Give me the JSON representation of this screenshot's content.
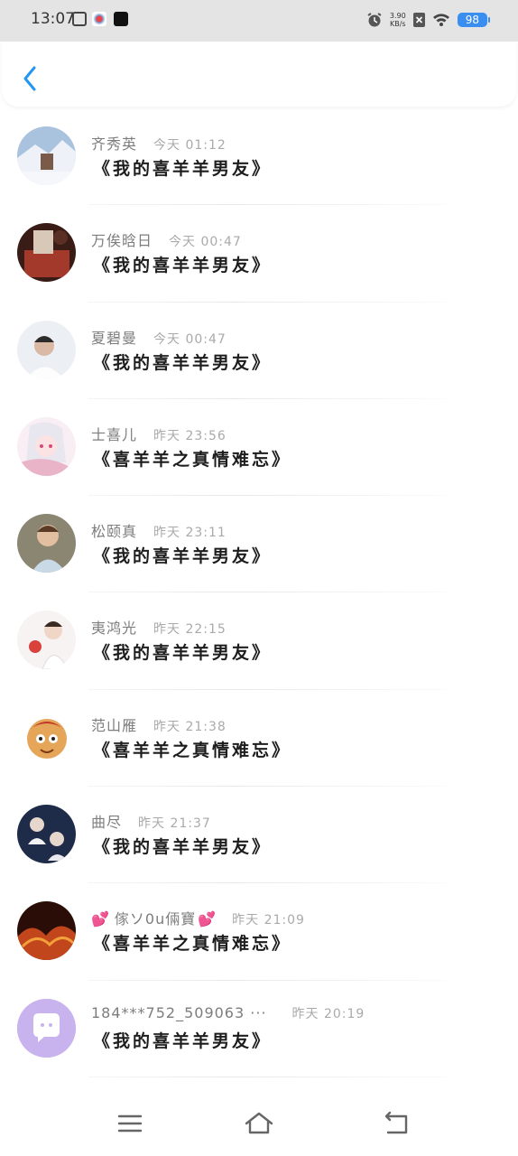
{
  "status_bar": {
    "time": "13:07",
    "net_speed_value": "3.90",
    "net_speed_unit": "KB/s",
    "battery": "98"
  },
  "comments": [
    {
      "user": "齐秀英",
      "time": "今天 01:12",
      "text": "《我的喜羊羊男友》"
    },
    {
      "user": "万俟晗日",
      "time": "今天 00:47",
      "text": "《我的喜羊羊男友》"
    },
    {
      "user": "夏碧曼",
      "time": "今天 00:47",
      "text": "《我的喜羊羊男友》"
    },
    {
      "user": "士喜儿",
      "time": "昨天 23:56",
      "text": "《喜羊羊之真情难忘》"
    },
    {
      "user": "松颐真",
      "time": "昨天 23:11",
      "text": "《我的喜羊羊男友》"
    },
    {
      "user": "夷鸿光",
      "time": "昨天 22:15",
      "text": "《我的喜羊羊男友》"
    },
    {
      "user": "范山雁",
      "time": "昨天 21:38",
      "text": "《喜羊羊之真情难忘》"
    },
    {
      "user": "曲尽",
      "time": "昨天 21:37",
      "text": "《我的喜羊羊男友》"
    },
    {
      "user": "傢ソ0u倆寶",
      "time": "昨天 21:09",
      "text": "《喜羊羊之真情难忘》"
    },
    {
      "user": "184***752_509063 ···",
      "time": "昨天 20:19",
      "text": "《我的喜羊羊男友》"
    }
  ],
  "colors": {
    "accent": "#2196f3",
    "battery": "#3a8ef0",
    "default_avatar_bg": "#c9b3ee"
  }
}
